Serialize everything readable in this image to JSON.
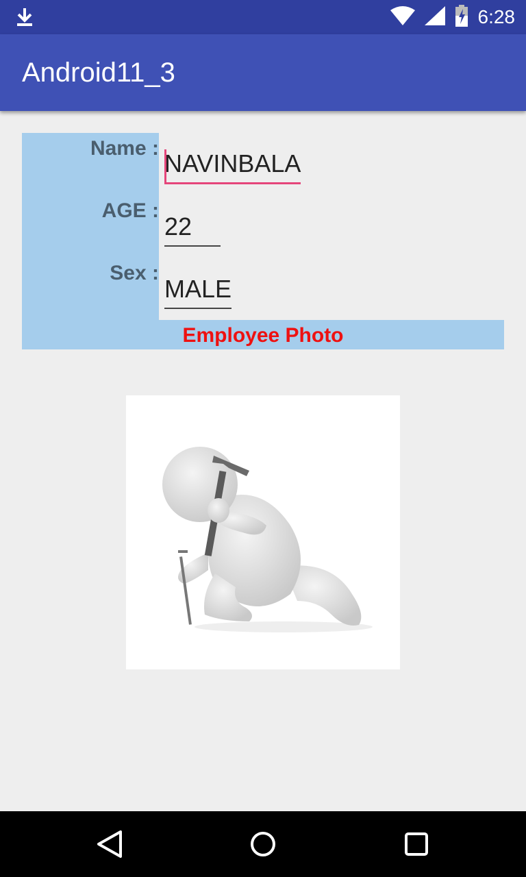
{
  "status_bar": {
    "time": "6:28",
    "icons": [
      "download-icon",
      "wifi-icon",
      "signal-icon",
      "battery-charging-icon"
    ]
  },
  "app_bar": {
    "title": "Android11_3"
  },
  "form": {
    "name_label": "Name :",
    "name_value": "NAVINBALA",
    "age_label": "AGE :",
    "age_value": "22",
    "sex_label": "Sex :",
    "sex_value": "MALE"
  },
  "photo_section": {
    "title": "Employee Photo",
    "image": "3d-figure-hammering-nail-illustration"
  },
  "colors": {
    "status_bar": "#303F9F",
    "app_bar": "#3F51B5",
    "label_bg": "#A5CDEC",
    "accent": "#E5457A",
    "photo_title": "#ee1111"
  },
  "nav_bar": {
    "buttons": [
      "back",
      "home",
      "recents"
    ]
  }
}
